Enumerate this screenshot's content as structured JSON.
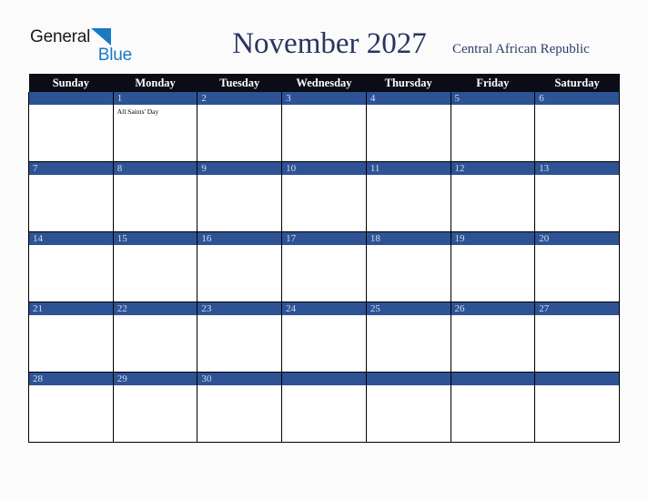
{
  "brand": {
    "name_part1": "General",
    "name_part2": "Blue",
    "color_dark": "#1b1b1b",
    "color_blue": "#1a7ac4",
    "triangle_icon": "blue-triangle-icon"
  },
  "header": {
    "month_title": "November 2027",
    "country": "Central African Republic",
    "title_color": "#28375e"
  },
  "calendar": {
    "accent_color": "#2e5395",
    "header_bg_color": "#0c0c18",
    "weekday_headers": [
      "Sunday",
      "Monday",
      "Tuesday",
      "Wednesday",
      "Thursday",
      "Friday",
      "Saturday"
    ],
    "weeks": [
      [
        {
          "day": "",
          "holidays": []
        },
        {
          "day": "1",
          "holidays": [
            "All Saints' Day"
          ]
        },
        {
          "day": "2",
          "holidays": []
        },
        {
          "day": "3",
          "holidays": []
        },
        {
          "day": "4",
          "holidays": []
        },
        {
          "day": "5",
          "holidays": []
        },
        {
          "day": "6",
          "holidays": []
        }
      ],
      [
        {
          "day": "7",
          "holidays": []
        },
        {
          "day": "8",
          "holidays": []
        },
        {
          "day": "9",
          "holidays": []
        },
        {
          "day": "10",
          "holidays": []
        },
        {
          "day": "11",
          "holidays": []
        },
        {
          "day": "12",
          "holidays": []
        },
        {
          "day": "13",
          "holidays": []
        }
      ],
      [
        {
          "day": "14",
          "holidays": []
        },
        {
          "day": "15",
          "holidays": []
        },
        {
          "day": "16",
          "holidays": []
        },
        {
          "day": "17",
          "holidays": []
        },
        {
          "day": "18",
          "holidays": []
        },
        {
          "day": "19",
          "holidays": []
        },
        {
          "day": "20",
          "holidays": []
        }
      ],
      [
        {
          "day": "21",
          "holidays": []
        },
        {
          "day": "22",
          "holidays": []
        },
        {
          "day": "23",
          "holidays": []
        },
        {
          "day": "24",
          "holidays": []
        },
        {
          "day": "25",
          "holidays": []
        },
        {
          "day": "26",
          "holidays": []
        },
        {
          "day": "27",
          "holidays": []
        }
      ],
      [
        {
          "day": "28",
          "holidays": []
        },
        {
          "day": "29",
          "holidays": []
        },
        {
          "day": "30",
          "holidays": []
        },
        {
          "day": "",
          "holidays": []
        },
        {
          "day": "",
          "holidays": []
        },
        {
          "day": "",
          "holidays": []
        },
        {
          "day": "",
          "holidays": []
        }
      ]
    ]
  }
}
